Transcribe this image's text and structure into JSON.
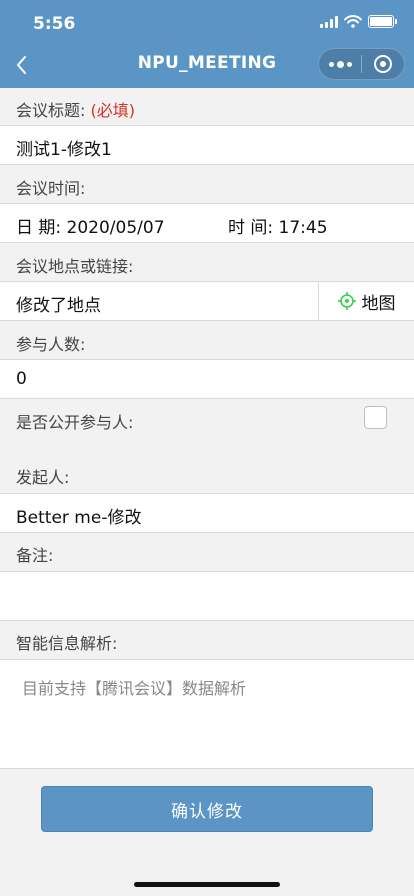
{
  "status": {
    "time": "5:56"
  },
  "nav": {
    "title": "NPU_MEETING"
  },
  "form": {
    "title_label": "会议标题:",
    "title_required": "(必填)",
    "title_value": "测试1-修改1",
    "time_label": "会议时间:",
    "date_prefix": "日  期:",
    "date_value": "2020/05/07",
    "time_prefix": "时  间:",
    "time_value": "17:45",
    "location_label": "会议地点或链接:",
    "location_value": "修改了地点",
    "map_button": "地图",
    "count_label": "参与人数:",
    "count_value": "0",
    "public_label": "是否公开参与人:",
    "initiator_label": "发起人:",
    "initiator_value": "Better me-修改",
    "notes_label": "备注:",
    "parse_label": "智能信息解析:",
    "parse_placeholder": "目前支持【腾讯会议】数据解析",
    "submit": "确认修改"
  },
  "colors": {
    "primary": "#5b95c6",
    "required": "#d93025",
    "map_icon": "#3bd14a"
  }
}
